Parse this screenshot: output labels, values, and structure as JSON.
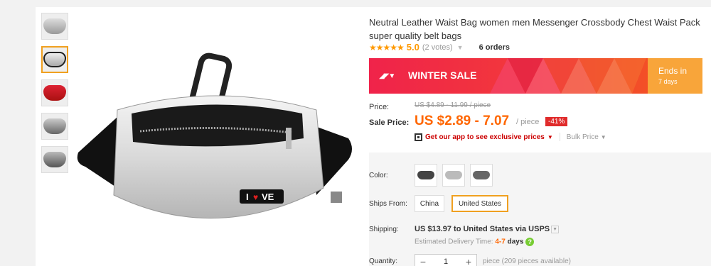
{
  "product": {
    "title": "Neutral Leather Waist Bag women men Messenger Crossbody Chest Waist Pack super quality belt bags",
    "stars": "★★★★★",
    "rating": "5.0",
    "votes": "(2 votes)",
    "orders": "6 orders"
  },
  "banner": {
    "label": "WINTER SALE",
    "ends": "Ends in",
    "days": "7 days",
    "colors": [
      "#f0234a",
      "#f45a1d",
      "#f8a53a"
    ]
  },
  "price": {
    "label": "Price:",
    "original": "US $4.89 - 11.99 / piece",
    "sale_label": "Sale Price:",
    "sale": "US $2.89 - 7.07",
    "per": "/ piece",
    "discount": "-41%",
    "app_text": "Get our app to see exclusive prices",
    "bulk": "Bulk Price"
  },
  "options": {
    "color_label": "Color:",
    "ships_from_label": "Ships From:",
    "ships_from": [
      "China",
      "United States"
    ],
    "ships_from_selected": "United States"
  },
  "shipping": {
    "label": "Shipping:",
    "value": "US $13.97 to United States via USPS",
    "est_label": "Estimated Delivery Time:",
    "est_range": "4-7",
    "est_unit": "days"
  },
  "quantity": {
    "label": "Quantity:",
    "value": "1",
    "info": "piece (209 pieces available)"
  },
  "icons": [
    "qr-code-icon",
    "help-icon",
    "chevron-down-icon",
    "minus-icon",
    "plus-icon"
  ]
}
